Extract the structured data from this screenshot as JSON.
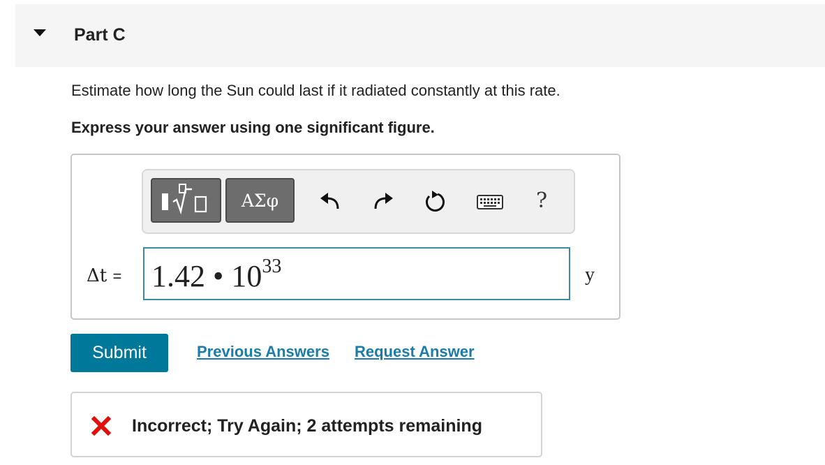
{
  "header": {
    "part_label": "Part C",
    "toggle_icon": "triangle-down-icon"
  },
  "question": {
    "text": "Estimate how long the Sun could last if it radiated constantly at this rate.",
    "instruction": "Express your answer using one significant figure."
  },
  "toolbar": {
    "templates_icon": "templates-radical-icon",
    "greek_label": "ΑΣφ",
    "undo_icon": "undo-icon",
    "redo_icon": "redo-icon",
    "reset_icon": "reset-icon",
    "keyboard_icon": "keyboard-icon",
    "help_label": "?"
  },
  "answer": {
    "variable": "Δt",
    "equals": "=",
    "mantissa": "1.42",
    "operator": "•",
    "base": "10",
    "exponent": "33",
    "unit": "y"
  },
  "actions": {
    "submit_label": "Submit",
    "previous_answers_label": "Previous Answers",
    "request_answer_label": "Request Answer"
  },
  "feedback": {
    "icon": "x-icon",
    "message": "Incorrect; Try Again; 2 attempts remaining",
    "icon_color": "#e0110c"
  },
  "colors": {
    "accent": "#00789a",
    "link": "#1a7ca8",
    "input_border": "#3a8ba5"
  }
}
